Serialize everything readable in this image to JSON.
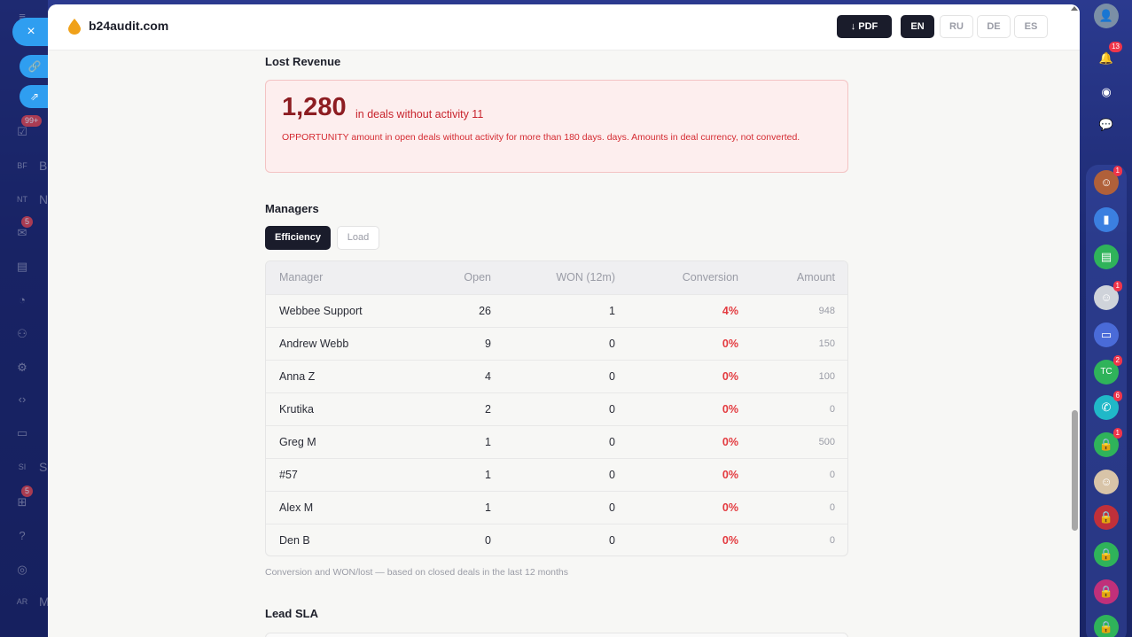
{
  "window": {
    "site_name": "b24audit.com"
  },
  "toolbar": {
    "pdf_label": "↓ PDF",
    "languages": [
      {
        "code": "EN",
        "active": true
      },
      {
        "code": "RU",
        "active": false
      },
      {
        "code": "DE",
        "active": false
      },
      {
        "code": "ES",
        "active": false
      }
    ]
  },
  "left_sidebar": {
    "close_icon": "×",
    "items": [
      {
        "initials": "BF",
        "label": "B"
      },
      {
        "initials": "NT",
        "label": "N"
      },
      {
        "initials": "SI",
        "label": "S"
      },
      {
        "initials": "AR",
        "label": "M"
      }
    ],
    "badges": [
      "99+",
      "5",
      "5"
    ]
  },
  "lost_revenue": {
    "title": "Lost Revenue",
    "amount": "1,280",
    "suffix": "in deals without activity 11",
    "description": "OPPORTUNITY amount in open deals without activity for more than 180 days. days. Amounts in deal currency, not converted."
  },
  "managers": {
    "title": "Managers",
    "tabs": [
      {
        "label": "Efficiency",
        "active": true
      },
      {
        "label": "Load",
        "active": false
      }
    ],
    "columns": [
      "Manager",
      "Open",
      "WON (12m)",
      "Conversion",
      "Amount"
    ],
    "rows": [
      {
        "manager": "Webbee Support",
        "open": "26",
        "won": "1",
        "conversion": "4%",
        "amount": "948"
      },
      {
        "manager": "Andrew Webb",
        "open": "9",
        "won": "0",
        "conversion": "0%",
        "amount": "150"
      },
      {
        "manager": "Anna Z",
        "open": "4",
        "won": "0",
        "conversion": "0%",
        "amount": "100"
      },
      {
        "manager": "Krutika",
        "open": "2",
        "won": "0",
        "conversion": "0%",
        "amount": "0"
      },
      {
        "manager": "Greg M",
        "open": "1",
        "won": "0",
        "conversion": "0%",
        "amount": "500"
      },
      {
        "manager": "#57",
        "open": "1",
        "won": "0",
        "conversion": "0%",
        "amount": "0"
      },
      {
        "manager": "Alex M",
        "open": "1",
        "won": "0",
        "conversion": "0%",
        "amount": "0"
      },
      {
        "manager": "Den B",
        "open": "0",
        "won": "0",
        "conversion": "0%",
        "amount": "0"
      }
    ],
    "footnote": "Conversion and WON/lost — based on closed deals in the last 12 months"
  },
  "lead_sla": {
    "title": "Lead SLA"
  },
  "right_rail": {
    "badges": [
      "13",
      "1",
      "1",
      "2",
      "6",
      "1"
    ],
    "tc_label": "TC"
  },
  "colors": {
    "accent_dark": "#1a1c2b",
    "alert_red": "#d42a31",
    "brand_orange": "#f0a11a",
    "sidebar_blue": "#2f9ef0"
  }
}
